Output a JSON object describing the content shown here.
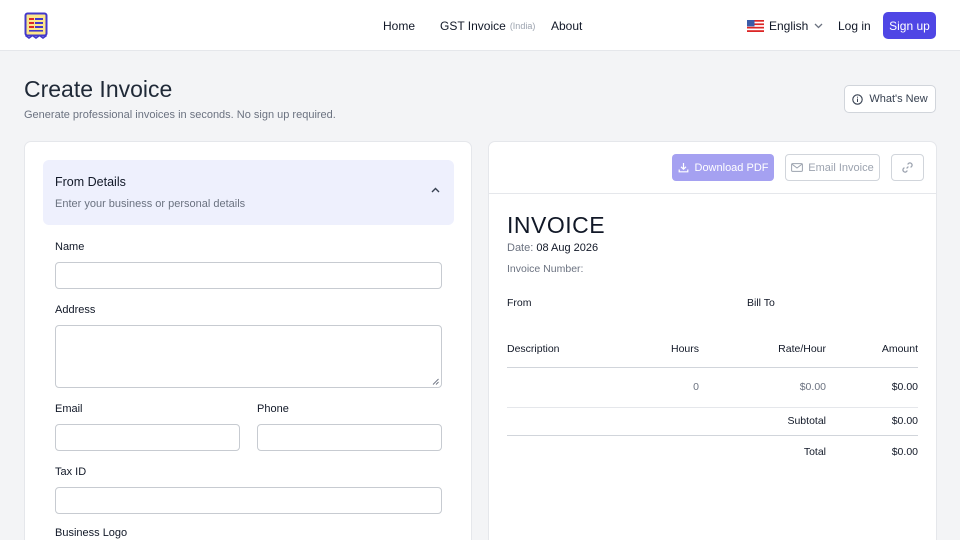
{
  "nav": {
    "home": "Home",
    "gst_invoice": "GST Invoice",
    "gst_region": "(India)",
    "about": "About",
    "language": "English",
    "login": "Log in",
    "signup": "Sign up"
  },
  "header": {
    "title": "Create Invoice",
    "subtitle": "Generate professional invoices in seconds. No sign up required.",
    "whats_new": "What's New"
  },
  "form": {
    "section_title": "From Details",
    "section_desc": "Enter your business or personal details",
    "fields": {
      "name": {
        "label": "Name",
        "value": ""
      },
      "address": {
        "label": "Address",
        "value": ""
      },
      "email": {
        "label": "Email",
        "value": ""
      },
      "phone": {
        "label": "Phone",
        "value": ""
      },
      "tax_id": {
        "label": "Tax ID",
        "value": ""
      },
      "logo": {
        "label": "Business Logo"
      }
    }
  },
  "preview": {
    "download_pdf": "Download PDF",
    "email_invoice": "Email Invoice",
    "title": "INVOICE",
    "date_label": "Date:",
    "date_value": "08 Aug 2026",
    "invoice_number_label": "Invoice Number:",
    "from_label": "From",
    "bill_to_label": "Bill To",
    "columns": [
      "Description",
      "Hours",
      "Rate/Hour",
      "Amount"
    ],
    "rows": [
      {
        "description": "",
        "hours": "0",
        "rate": "$0.00",
        "amount": "$0.00"
      }
    ],
    "subtotal_label": "Subtotal",
    "subtotal_value": "$0.00",
    "total_label": "Total",
    "total_value": "$0.00"
  },
  "colors": {
    "accent": "#4f46e5",
    "accent_disabled": "#a5a1f1",
    "section_bg": "#eef0fd",
    "page_bg": "#f3f4f6"
  },
  "icons": {
    "logo": "receipt-icon",
    "flag": "us-flag-icon",
    "language_chevron": "chevron-down-icon",
    "whats_new": "info-icon",
    "section_toggle": "chevron-up-icon",
    "download": "download-icon",
    "email": "mail-icon",
    "share": "link-icon"
  }
}
